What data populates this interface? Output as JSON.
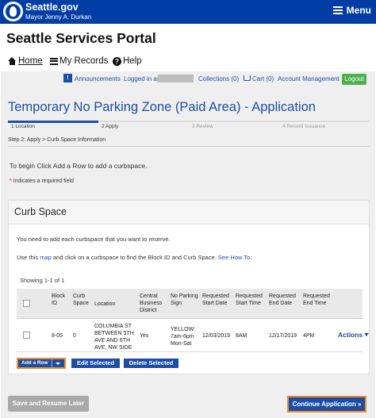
{
  "header": {
    "brand": "Seattle.gov",
    "mayor": "Mayor Jenny A. Durkan",
    "menu_label": "Menu"
  },
  "portal_title": "Seattle Services Portal",
  "nav": {
    "home": "Home",
    "records": "My Records",
    "help": "Help"
  },
  "account_bar": {
    "announcements": "Announcements",
    "logged_in": "Logged in as",
    "collections": "Collections (0)",
    "cart": "Cart (0)",
    "account_management": "Account Management",
    "logout": "Logout"
  },
  "app_title": "Temporary No Parking Zone (Paid Area) - Application",
  "steps": [
    {
      "label": "1 Location"
    },
    {
      "label": "2 Apply"
    },
    {
      "label": "3 Review"
    },
    {
      "label": "4 Record Issuance"
    }
  ],
  "breadcrumb": "Step 2: Apply > Curb Space Information",
  "intro_text": "To begin Click Add a Row to add a curbspace.",
  "required_note": {
    "star": "*",
    "text": " Indicates a required field"
  },
  "curb_space": {
    "title": "Curb Space",
    "instruction": "You need to add each curbspace that you want to reserve.",
    "map_text": {
      "prefix": "Use this ",
      "map_link": "map",
      "middle": " and click on a curbspace to find the Block ID and Curb Space. ",
      "how_link": "See How To."
    },
    "showing": "Showing 1-1 of 1",
    "columns": {
      "block_id": "Block ID",
      "curb_space": "Curb Space",
      "location": "Location",
      "cbd": "Central Business District",
      "no_parking_sign": "No Parking Sign",
      "start_date": "Requested Start Date",
      "start_time": "Requested Start Time",
      "end_date": "Requested End Date",
      "end_time": "Requested End Time"
    },
    "row": {
      "block_id": "8-05",
      "curb_space": "0",
      "location": "COLUMBIA ST BETWEEN 5TH AVE AND 6TH AVE, NW SIDE",
      "cbd": "Yes",
      "no_parking_sign": "YELLOW: 7am-6pm Mon-Sat",
      "start_date": "12/03/2019",
      "start_time": "8AM",
      "end_date": "12/17/2019",
      "end_time": "4PM",
      "actions": "Actions"
    },
    "add_row": "Add a Row",
    "edit_selected": "Edit Selected",
    "delete_selected": "Delete Selected"
  },
  "footer_buttons": {
    "save": "Save and Resume Later",
    "continue": "Continue Application »"
  },
  "colors": {
    "header_blue": "#003da5",
    "link_blue": "#1d4ea7",
    "highlight_orange": "#f08a24",
    "logout_green": "#4caf50"
  }
}
